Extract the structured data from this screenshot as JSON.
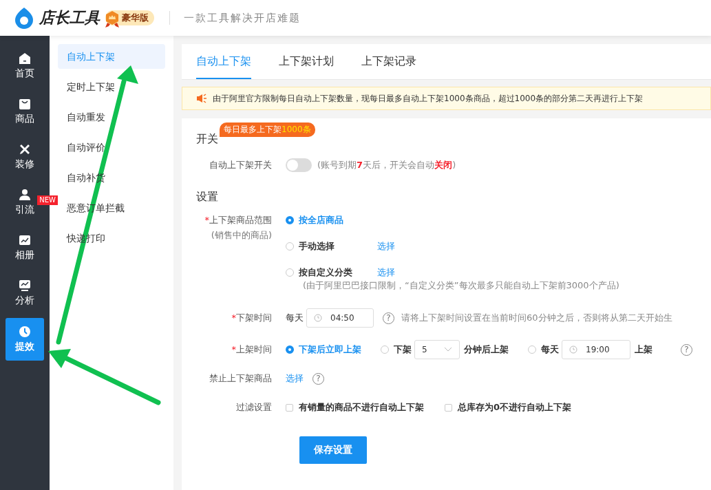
{
  "header": {
    "logo_text": "店长工具",
    "edition": "豪华版",
    "slogan": "一款工具解决开店难题"
  },
  "nav": [
    {
      "label": "首页",
      "kind": "home",
      "selected": false
    },
    {
      "label": "商品",
      "kind": "bag",
      "selected": false
    },
    {
      "label": "装修",
      "kind": "tools",
      "selected": false
    },
    {
      "label": "引流",
      "kind": "person",
      "selected": false,
      "badge": "NEW"
    },
    {
      "label": "相册",
      "kind": "photo",
      "selected": false
    },
    {
      "label": "分析",
      "kind": "chart",
      "selected": false
    },
    {
      "label": "提效",
      "kind": "clock",
      "selected": true
    }
  ],
  "submenu": [
    {
      "label": "自动上下架",
      "selected": true
    },
    {
      "label": "定时上下架",
      "selected": false
    },
    {
      "label": "自动重发",
      "selected": false
    },
    {
      "label": "自动评价",
      "selected": false
    },
    {
      "label": "自动补货",
      "selected": false
    },
    {
      "label": "恶意订单拦截",
      "selected": false
    },
    {
      "label": "快递打印",
      "selected": false
    }
  ],
  "tabs": [
    {
      "label": "自动上下架",
      "selected": true
    },
    {
      "label": "上下架计划",
      "selected": false
    },
    {
      "label": "上下架记录",
      "selected": false
    }
  ],
  "notice": "由于阿里官方限制每日自动上下架数量，现每日最多自动上下架1000条商品，超过1000条的部分第二天再进行上下架",
  "switch_section": {
    "title": "开关",
    "tag": {
      "text": "每日最多上下架",
      "highlight": "1000条"
    },
    "label": "自动上下架开关",
    "on": false,
    "hint": [
      {
        "text": "(账号到期",
        "emphasis": false
      },
      {
        "text": "7",
        "emphasis": true
      },
      {
        "text": "天后，开关会自动",
        "emphasis": false
      },
      {
        "text": "关闭",
        "emphasis": true
      },
      {
        "text": ")",
        "emphasis": false
      }
    ]
  },
  "settings": {
    "title": "设置",
    "range": {
      "label": "上下架商品范围",
      "required_mark": "*",
      "sublabel": "(销售中的商品)",
      "options": [
        {
          "label": "按全店商品",
          "selected": true
        },
        {
          "label": "手动选择",
          "selected": false,
          "link": "选择"
        },
        {
          "label": "按自定义分类",
          "selected": false,
          "link": "选择"
        }
      ],
      "note": "(由于阿里巴巴接口限制，“自定义分类”每次最多只能自动上下架前3000个产品)"
    },
    "down_time": {
      "label": "下架时间",
      "required_mark": "*",
      "prefix": "每天",
      "time": "04:50",
      "help": "?",
      "hint": "请将上下架时间设置在当前时间60分钟之后，否则将从第二天开始生"
    },
    "up_time": {
      "label": "上架时间",
      "required_mark": "*",
      "help": "?",
      "options": [
        {
          "kind": "plain",
          "selected": true,
          "label": "下架后立即上架"
        },
        {
          "kind": "select",
          "selected": false,
          "label": "下架",
          "value": "5",
          "suffix": "分钟后上架"
        },
        {
          "kind": "time",
          "selected": false,
          "label": "每天",
          "value": "19:00",
          "suffix": "上架"
        }
      ]
    },
    "forbidden": {
      "label": "禁止上下架商品",
      "link": "选择",
      "help": "?"
    },
    "filter": {
      "label": "过滤设置",
      "options": [
        {
          "label": "有销量的商品不进行自动上下架",
          "checked": false
        },
        {
          "label": "总库存为0不进行自动上下架",
          "checked": false
        }
      ]
    },
    "save": "保存设置"
  }
}
